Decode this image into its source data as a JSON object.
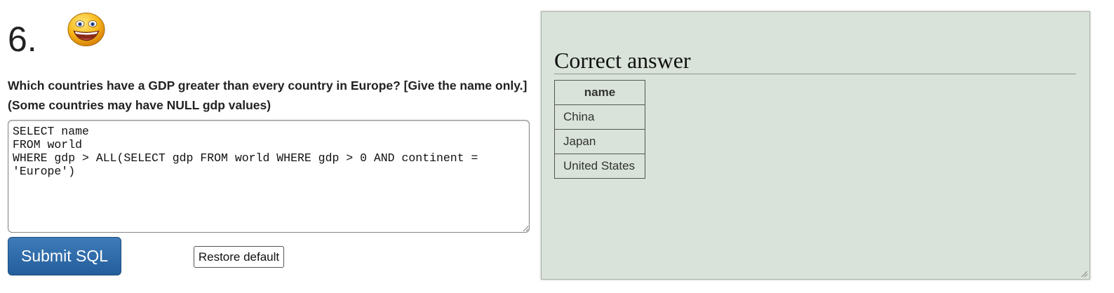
{
  "question": {
    "number": "6.",
    "text_line1": "Which countries have a GDP greater than every country in Europe? [Give the name only.]",
    "text_line2": "(Some countries may have NULL gdp values)",
    "icon": "smiley-face-icon"
  },
  "editor": {
    "sql": "SELECT name\nFROM world\nWHERE gdp > ALL(SELECT gdp FROM world WHERE gdp > 0 AND continent = 'Europe')"
  },
  "buttons": {
    "submit_label": "Submit SQL",
    "restore_label": "Restore default"
  },
  "answer": {
    "title": "Correct answer",
    "columns": [
      "name"
    ],
    "rows": [
      [
        "China"
      ],
      [
        "Japan"
      ],
      [
        "United States"
      ]
    ]
  },
  "colors": {
    "panel_bg": "#d9e3d9",
    "submit_bg": "#2f6ca8"
  }
}
